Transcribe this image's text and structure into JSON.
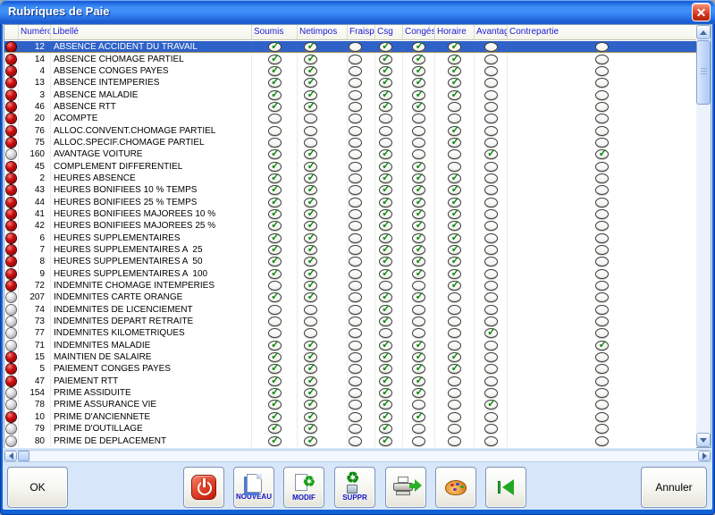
{
  "window": {
    "title": "Rubriques de Paie"
  },
  "icons": {
    "close": "close-icon",
    "exit": "power-icon",
    "nouveau": "new-document-icon",
    "modif": "modify-document-icon",
    "suppr": "delete-recycle-icon",
    "print": "printer-arrow-icon",
    "palette": "palette-icon",
    "first": "first-record-icon",
    "row_red": "red-sphere-status-icon",
    "row_gray": "gray-sphere-status-icon",
    "checked": "green-check-icon"
  },
  "colors": {
    "titlebar_blue": "#1E61D4",
    "frame_blue": "#1261D6",
    "dialog_face": "#D7E7F9",
    "selection_blue": "#2E62C8",
    "header_text_blue": "#1A1AD2",
    "check_green": "#0E8A12",
    "status_red": "#C01010",
    "status_gray": "#B0B0B0"
  },
  "columns": [
    {
      "key": "icon",
      "label": ""
    },
    {
      "key": "numero",
      "label": "Numéro"
    },
    {
      "key": "libelle",
      "label": "Libellé"
    },
    {
      "key": "soumis",
      "label": "Soumis"
    },
    {
      "key": "netimpos",
      "label": "Netimpos"
    },
    {
      "key": "fraispro",
      "label": "Fraispro"
    },
    {
      "key": "csg",
      "label": "Csg"
    },
    {
      "key": "conges",
      "label": "Congés"
    },
    {
      "key": "horaire",
      "label": "Horaire"
    },
    {
      "key": "avantage",
      "label": "Avantage"
    },
    {
      "key": "contrepartie",
      "label": "Contrepartie"
    }
  ],
  "check_keys": [
    "soumis",
    "netimpos",
    "fraispro",
    "csg",
    "conges",
    "horaire",
    "avantage",
    "contrepartie"
  ],
  "rows": [
    {
      "num": "12",
      "label": "ABSENCE ACCIDENT DU TRAVAIL",
      "status": "red",
      "selected": true,
      "checks": [
        1,
        1,
        0,
        1,
        1,
        1,
        0,
        0
      ]
    },
    {
      "num": "14",
      "label": "ABSENCE CHOMAGE PARTIEL",
      "status": "red",
      "selected": false,
      "checks": [
        1,
        1,
        0,
        1,
        1,
        1,
        0,
        0
      ]
    },
    {
      "num": "4",
      "label": "ABSENCE CONGES PAYES",
      "status": "red",
      "selected": false,
      "checks": [
        1,
        1,
        0,
        1,
        1,
        1,
        0,
        0
      ]
    },
    {
      "num": "13",
      "label": "ABSENCE INTEMPERIES",
      "status": "red",
      "selected": false,
      "checks": [
        1,
        1,
        0,
        1,
        1,
        1,
        0,
        0
      ]
    },
    {
      "num": "3",
      "label": "ABSENCE MALADIE",
      "status": "red",
      "selected": false,
      "checks": [
        1,
        1,
        0,
        1,
        1,
        1,
        0,
        0
      ]
    },
    {
      "num": "46",
      "label": "ABSENCE RTT",
      "status": "red",
      "selected": false,
      "checks": [
        1,
        1,
        0,
        1,
        1,
        0,
        0,
        0
      ]
    },
    {
      "num": "20",
      "label": "ACOMPTE",
      "status": "red",
      "selected": false,
      "checks": [
        0,
        0,
        0,
        0,
        0,
        0,
        0,
        0
      ]
    },
    {
      "num": "76",
      "label": "ALLOC.CONVENT.CHOMAGE PARTIEL",
      "status": "red",
      "selected": false,
      "checks": [
        0,
        0,
        0,
        0,
        0,
        1,
        0,
        0
      ]
    },
    {
      "num": "75",
      "label": "ALLOC.SPECIF.CHOMAGE PARTIEL",
      "status": "red",
      "selected": false,
      "checks": [
        0,
        0,
        0,
        0,
        0,
        1,
        0,
        0
      ]
    },
    {
      "num": "160",
      "label": "AVANTAGE VOITURE",
      "status": "gray",
      "selected": false,
      "checks": [
        1,
        1,
        0,
        1,
        0,
        0,
        1,
        1
      ]
    },
    {
      "num": "45",
      "label": "COMPLEMENT DIFFERENTIEL",
      "status": "red",
      "selected": false,
      "checks": [
        1,
        1,
        0,
        1,
        1,
        0,
        0,
        0
      ]
    },
    {
      "num": "2",
      "label": "HEURES ABSENCE",
      "status": "red",
      "selected": false,
      "checks": [
        1,
        1,
        0,
        1,
        1,
        1,
        0,
        0
      ]
    },
    {
      "num": "43",
      "label": "HEURES BONIFIEES 10 % TEMPS",
      "status": "red",
      "selected": false,
      "checks": [
        1,
        1,
        0,
        1,
        1,
        1,
        0,
        0
      ]
    },
    {
      "num": "44",
      "label": "HEURES BONIFIEES 25 % TEMPS",
      "status": "red",
      "selected": false,
      "checks": [
        1,
        1,
        0,
        1,
        1,
        1,
        0,
        0
      ]
    },
    {
      "num": "41",
      "label": "HEURES BONIFIEES MAJOREES 10 %",
      "status": "red",
      "selected": false,
      "checks": [
        1,
        1,
        0,
        1,
        1,
        1,
        0,
        0
      ]
    },
    {
      "num": "42",
      "label": "HEURES BONIFIEES MAJOREES 25 %",
      "status": "red",
      "selected": false,
      "checks": [
        1,
        1,
        0,
        1,
        1,
        1,
        0,
        0
      ]
    },
    {
      "num": "6",
      "label": "HEURES SUPPLEMENTAIRES",
      "status": "red",
      "selected": false,
      "checks": [
        1,
        1,
        0,
        1,
        1,
        1,
        0,
        0
      ]
    },
    {
      "num": "7",
      "label": "HEURES SUPPLEMENTAIRES A  25",
      "status": "red",
      "selected": false,
      "checks": [
        1,
        1,
        0,
        1,
        1,
        1,
        0,
        0
      ]
    },
    {
      "num": "8",
      "label": "HEURES SUPPLEMENTAIRES A  50",
      "status": "red",
      "selected": false,
      "checks": [
        1,
        1,
        0,
        1,
        1,
        1,
        0,
        0
      ]
    },
    {
      "num": "9",
      "label": "HEURES SUPPLEMENTAIRES A  100",
      "status": "red",
      "selected": false,
      "checks": [
        1,
        1,
        0,
        1,
        1,
        1,
        0,
        0
      ]
    },
    {
      "num": "72",
      "label": "INDEMNITE CHOMAGE INTEMPERIES",
      "status": "red",
      "selected": false,
      "checks": [
        0,
        1,
        0,
        0,
        0,
        1,
        0,
        0
      ]
    },
    {
      "num": "207",
      "label": "INDEMNITES CARTE ORANGE",
      "status": "gray",
      "selected": false,
      "checks": [
        1,
        1,
        0,
        1,
        1,
        0,
        0,
        0
      ]
    },
    {
      "num": "74",
      "label": "INDEMNITES DE LICENCIEMENT",
      "status": "gray",
      "selected": false,
      "checks": [
        0,
        0,
        0,
        1,
        0,
        0,
        0,
        0
      ]
    },
    {
      "num": "73",
      "label": "INDEMNITES DEPART RETRAITE",
      "status": "gray",
      "selected": false,
      "checks": [
        0,
        0,
        0,
        1,
        0,
        0,
        0,
        0
      ]
    },
    {
      "num": "77",
      "label": "INDEMNITES KILOMETRIQUES",
      "status": "gray",
      "selected": false,
      "checks": [
        0,
        0,
        0,
        0,
        0,
        0,
        1,
        0
      ]
    },
    {
      "num": "71",
      "label": "INDEMNITES MALADIE",
      "status": "gray",
      "selected": false,
      "checks": [
        1,
        1,
        0,
        1,
        1,
        0,
        0,
        1
      ]
    },
    {
      "num": "15",
      "label": "MAINTIEN DE SALAIRE",
      "status": "red",
      "selected": false,
      "checks": [
        1,
        1,
        0,
        1,
        1,
        1,
        0,
        0
      ]
    },
    {
      "num": "5",
      "label": "PAIEMENT CONGES PAYES",
      "status": "red",
      "selected": false,
      "checks": [
        1,
        1,
        0,
        1,
        1,
        1,
        0,
        0
      ]
    },
    {
      "num": "47",
      "label": "PAIEMENT RTT",
      "status": "red",
      "selected": false,
      "checks": [
        1,
        1,
        0,
        1,
        1,
        0,
        0,
        0
      ]
    },
    {
      "num": "154",
      "label": "PRIME ASSIDUITE",
      "status": "gray",
      "selected": false,
      "checks": [
        1,
        1,
        0,
        1,
        1,
        0,
        0,
        0
      ]
    },
    {
      "num": "78",
      "label": "PRIME ASSURANCE VIE",
      "status": "gray",
      "selected": false,
      "checks": [
        1,
        1,
        0,
        1,
        0,
        0,
        1,
        0
      ]
    },
    {
      "num": "10",
      "label": "PRIME D'ANCIENNETE",
      "status": "red",
      "selected": false,
      "checks": [
        1,
        1,
        0,
        1,
        1,
        0,
        0,
        0
      ]
    },
    {
      "num": "79",
      "label": "PRIME D'OUTILLAGE",
      "status": "gray",
      "selected": false,
      "checks": [
        1,
        1,
        0,
        1,
        0,
        0,
        0,
        0
      ]
    },
    {
      "num": "80",
      "label": "PRIME DE DEPLACEMENT",
      "status": "gray",
      "selected": false,
      "checks": [
        1,
        1,
        0,
        1,
        0,
        0,
        0,
        0
      ]
    }
  ],
  "buttons": {
    "ok": "OK",
    "annuler": "Annuler",
    "nouveau": "NOUVEAU",
    "modif": "MODIF",
    "suppr": "SUPPR"
  }
}
